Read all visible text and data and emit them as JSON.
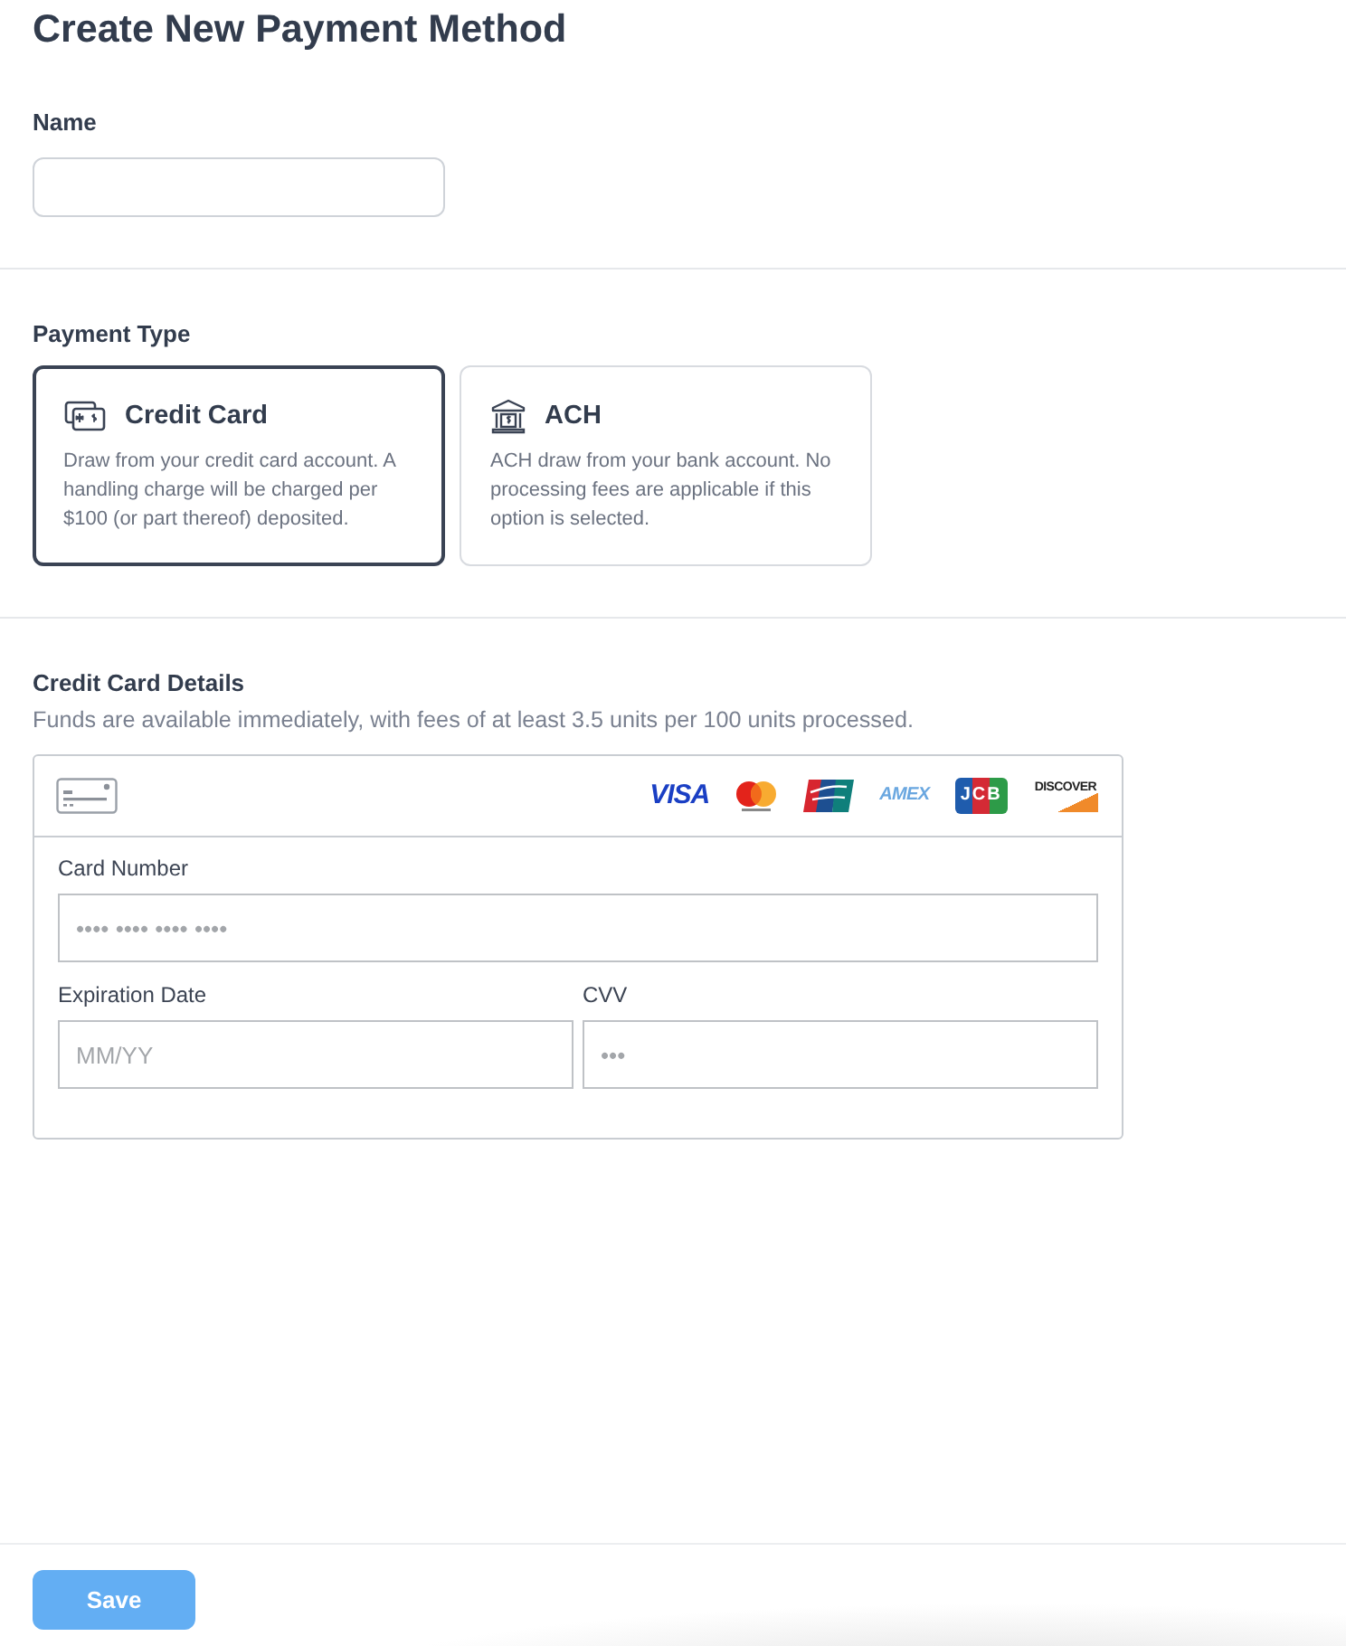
{
  "title": "Create New Payment Method",
  "name_field": {
    "label": "Name"
  },
  "payment_type": {
    "label": "Payment Type",
    "options": [
      {
        "kind": "card",
        "title": "Credit Card",
        "description": "Draw from your credit card account. A handling charge will be charged per $100 (or part thereof) deposited.",
        "selected": true
      },
      {
        "kind": "bank",
        "title": "ACH",
        "description": "ACH draw from your bank account. No processing fees are applicable if this option is selected.",
        "selected": false
      }
    ]
  },
  "card_details": {
    "title": "Credit Card Details",
    "note": "Funds are available immediately, with fees of at least 3.5 units per 100 units processed.",
    "brands": [
      {
        "kind": "visa",
        "label": "VISA"
      },
      {
        "kind": "mastercard"
      },
      {
        "kind": "unionpay"
      },
      {
        "kind": "amex",
        "label": "AMEX"
      },
      {
        "kind": "jcb",
        "label": "JCB"
      },
      {
        "kind": "discover",
        "label": "DISCOVER"
      }
    ],
    "card_number": {
      "label": "Card Number",
      "placeholder": "•••• •••• •••• ••••"
    },
    "expiration": {
      "label": "Expiration Date",
      "placeholder": "MM/YY"
    },
    "cvv": {
      "label": "CVV",
      "placeholder": "•••"
    }
  },
  "footer": {
    "save_button": {
      "label": "Save",
      "disabled": true
    }
  }
}
